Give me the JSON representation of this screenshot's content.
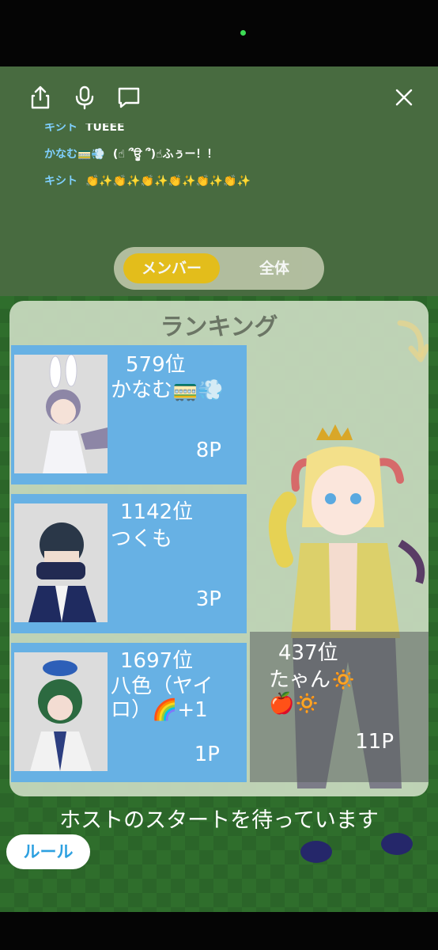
{
  "chat": [
    {
      "name": "キシト",
      "message": "TUEEE"
    },
    {
      "name": "かなむ🚃💨",
      "message": "(☝ ՞ਊ ՞)☝ふぅー！！"
    },
    {
      "name": "キシト",
      "message": "👏✨👏✨👏✨👏✨👏✨👏✨"
    }
  ],
  "tabs": {
    "member": "メンバー",
    "all": "全体"
  },
  "ranking_title": "ランキング",
  "ranking": [
    {
      "rank": "579位",
      "name": "かなむ🚃💨",
      "points": "8P"
    },
    {
      "rank": "1142位",
      "name": "つくも",
      "points": "3P"
    },
    {
      "rank": "1697位",
      "name": "八色（ヤイロ）🌈+1",
      "points": "1P"
    }
  ],
  "host": {
    "rank": "437位",
    "name": "たゃん🔅🍎🔅",
    "points": "11P"
  },
  "waiting_text": "ホストのスタートを待っています",
  "rule_button": "ルール",
  "colors": {
    "accent": "#ecc21a",
    "card": "#67b1e4",
    "chat_name": "#7fd0ff"
  }
}
